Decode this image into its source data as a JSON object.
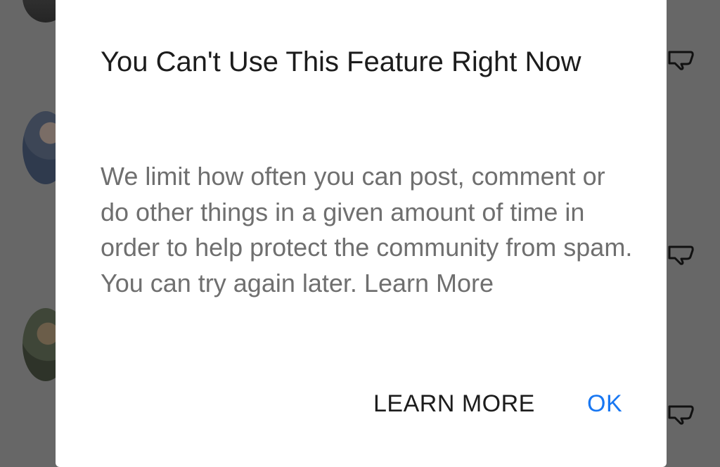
{
  "dialog": {
    "title": "You Can't Use This Feature Right Now",
    "message": "We limit how often you can post, comment or do other things in a given amount of time in order to help protect the community from spam. You can try again later. Learn More",
    "buttons": {
      "learn_more": "LEARN MORE",
      "ok": "OK"
    }
  },
  "background": {
    "icons": [
      "thumbs-down-icon",
      "thumbs-down-icon",
      "thumbs-down-icon"
    ]
  },
  "colors": {
    "accent": "#1877f2",
    "scrim": "#676767",
    "title_text": "#1c1c1c",
    "body_text": "#6f6f6f"
  }
}
